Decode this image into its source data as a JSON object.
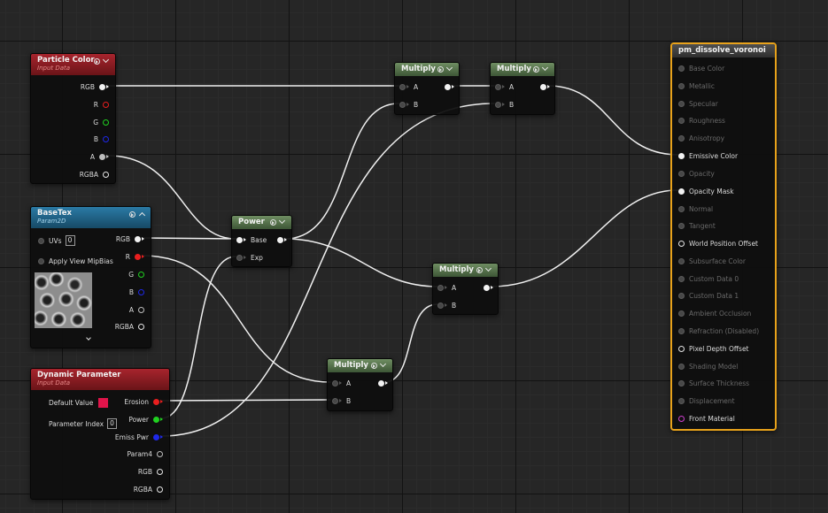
{
  "nodes": {
    "particle_color": {
      "title": "Particle Color",
      "subtitle": "Input Data",
      "outputs": [
        "RGB",
        "R",
        "G",
        "B",
        "A",
        "RGBA"
      ]
    },
    "base_tex": {
      "title": "BaseTex",
      "subtitle": "Param2D",
      "uvs_label": "UVs",
      "uvs_value": "0",
      "mip_label": "Apply View MipBias",
      "outputs": [
        "RGB",
        "R",
        "G",
        "B",
        "A",
        "RGBA"
      ]
    },
    "dynamic_param": {
      "title": "Dynamic Parameter",
      "subtitle": "Input Data",
      "default_value_label": "Default Value",
      "param_index_label": "Parameter Index",
      "param_index_value": "0",
      "outputs": [
        "Erosion",
        "Power",
        "Emiss Pwr",
        "Param4",
        "RGB",
        "RGBA"
      ]
    },
    "power": {
      "title": "Power",
      "inputs": [
        "Base",
        "Exp"
      ]
    },
    "multiply_1": {
      "title": "Multiply",
      "inputs": [
        "A",
        "B"
      ]
    },
    "multiply_2": {
      "title": "Multiply",
      "inputs": [
        "A",
        "B"
      ]
    },
    "multiply_3": {
      "title": "Multiply",
      "inputs": [
        "A",
        "B"
      ]
    },
    "multiply_4": {
      "title": "Multiply",
      "inputs": [
        "A",
        "B"
      ]
    },
    "result": {
      "title": "pm_dissolve_voronoi",
      "inputs": [
        "Base Color",
        "Metallic",
        "Specular",
        "Roughness",
        "Anisotropy",
        "Emissive Color",
        "Opacity",
        "Opacity Mask",
        "Normal",
        "Tangent",
        "World Position Offset",
        "Subsurface Color",
        "Custom Data 0",
        "Custom Data 1",
        "Ambient Occlusion",
        "Refraction (Disabled)",
        "Pixel Depth Offset",
        "Shading Model",
        "Surface Thickness",
        "Displacement",
        "Front Material"
      ]
    }
  },
  "colors": {
    "canvas": "#262626",
    "wire": "#f0f0f0",
    "pin_red": "#e81e1e",
    "pin_green": "#20d020",
    "pin_blue": "#1e28e8",
    "pin_magenta": "#d040d0",
    "selection": "#e8a21a",
    "default_value_swatch": "#e0144a"
  }
}
